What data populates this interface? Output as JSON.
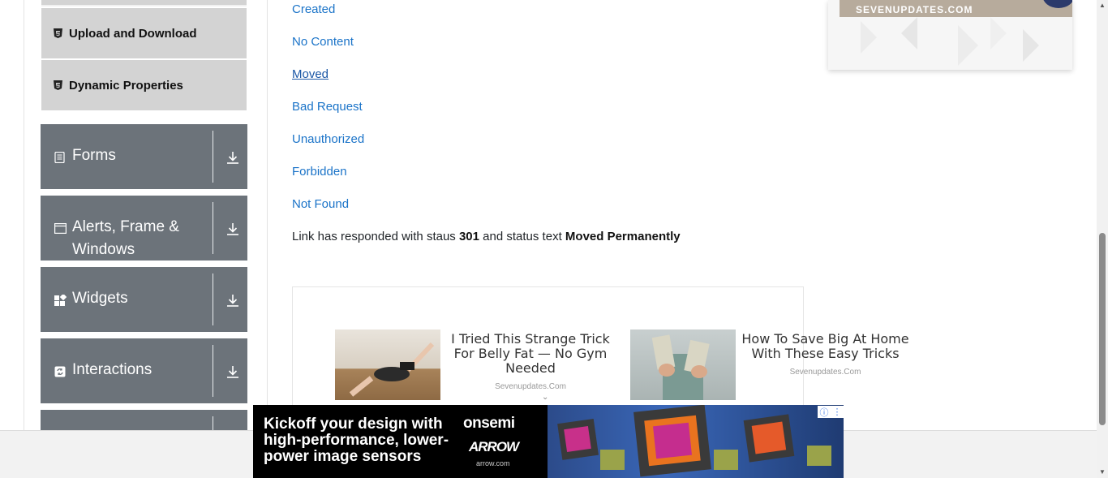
{
  "sidebar": {
    "sub_items": [
      {
        "label": "Upload and Download",
        "icon": "html5-icon"
      },
      {
        "label": "Dynamic Properties",
        "icon": "html5-icon"
      }
    ],
    "groups": [
      {
        "label": "Forms",
        "icon": "forms-icon"
      },
      {
        "label": "Alerts, Frame & Windows",
        "icon": "window-icon"
      },
      {
        "label": "Widgets",
        "icon": "widgets-icon"
      },
      {
        "label": "Interactions",
        "icon": "interactions-icon"
      }
    ]
  },
  "main": {
    "links": [
      "Created",
      "No Content",
      "Moved",
      "Bad Request",
      "Unauthorized",
      "Forbidden",
      "Not Found"
    ],
    "response": {
      "prefix": "Link has responded with staus",
      "status_code": "301",
      "middle": "and status text",
      "status_text": "Moved Permanently"
    }
  },
  "ads": {
    "top_right_banner": "SEVENUPDATES.COM",
    "cards": [
      {
        "title": "I Tried This Strange Trick For Belly Fat — No Gym Needed",
        "source": "Sevenupdates.Com"
      },
      {
        "title": "How To Save Big At Home With These Easy Tricks",
        "source": "Sevenupdates.Com"
      }
    ],
    "bottom": {
      "headline": "Kickoff your design with high-performance, lower-power image sensors",
      "brand1": "onsemi",
      "brand2": "ARROW",
      "brand3": "arrow.com"
    }
  },
  "colors": {
    "link": "#1a73c8",
    "sidebar_group_bg": "#6c737a",
    "sidebar_sub_bg": "#d3d3d3"
  }
}
